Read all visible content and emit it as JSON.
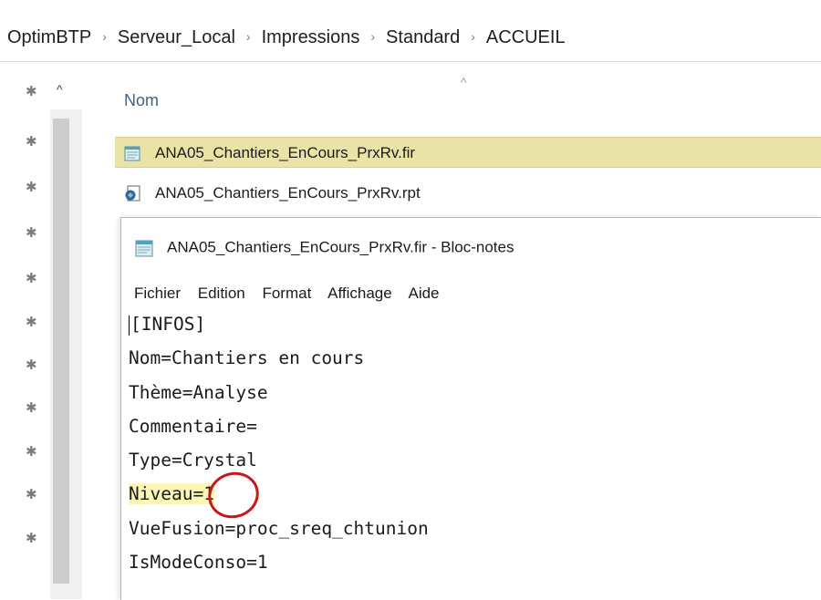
{
  "breadcrumb": [
    "OptimBTP",
    "Serveur_Local",
    "Impressions",
    "Standard",
    "ACCUEIL"
  ],
  "file_list": {
    "column_header": "Nom",
    "files": [
      {
        "name": "ANA05_Chantiers_EnCours_PrxRv.fir",
        "icon": "notepad-file-icon",
        "selected": true
      },
      {
        "name": "ANA05_Chantiers_EnCours_PrxRv.rpt",
        "icon": "crystal-report-icon",
        "selected": false
      }
    ]
  },
  "notepad": {
    "title": "ANA05_Chantiers_EnCours_PrxRv.fir - Bloc-notes",
    "menu": [
      "Fichier",
      "Edition",
      "Format",
      "Affichage",
      "Aide"
    ],
    "lines": [
      "[INFOS]",
      "Nom=Chantiers en cours",
      "Thème=Analyse",
      "Commentaire=",
      "Type=Crystal",
      "Niveau=1",
      "VueFusion=proc_sreq_chtunion",
      "IsModeConso=1"
    ],
    "highlighted_line_index": 5
  },
  "colors": {
    "selection": "#e9e4a6",
    "annotation_circle": "#c8161d",
    "line_highlight": "#fbf6b6"
  }
}
